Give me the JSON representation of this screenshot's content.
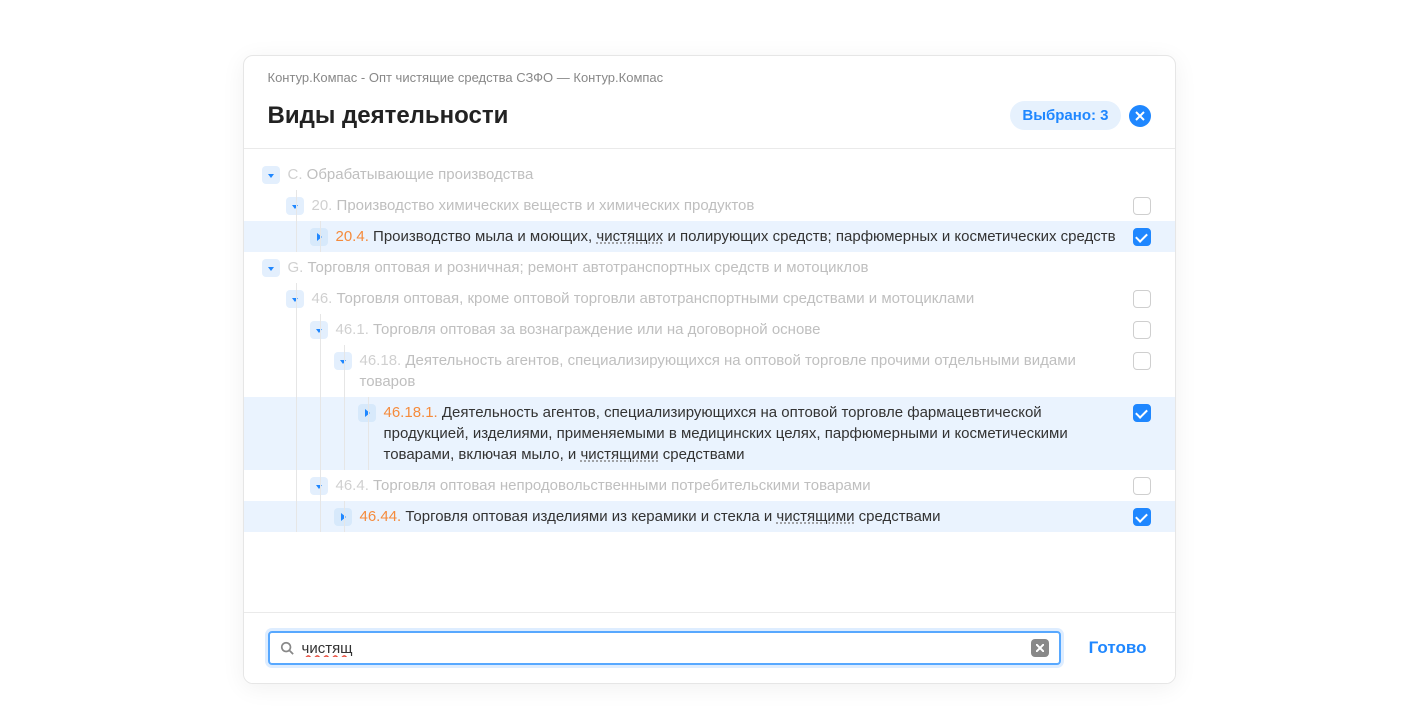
{
  "window_title": "Контур.Компас - Опт чистящие средства СЗФО — Контур.Компас",
  "page_title": "Виды деятельности",
  "selected_label": "Выбрано: 3",
  "done_label": "Готово",
  "search_value": "чистящ",
  "tree": {
    "c": {
      "code": "C.",
      "title": "Обрабатывающие производства",
      "c20": {
        "code": "20.",
        "title": "Производство химических веществ и химических продуктов",
        "c204": {
          "code": "20.4.",
          "pre": "Производство мыла и моющих, ",
          "match": "чистящих",
          "post": " и полирующих средств; парфюмерных и косметических средств"
        }
      }
    },
    "g": {
      "code": "G.",
      "title": "Торговля оптовая и розничная; ремонт автотранспортных средств и мотоциклов",
      "g46": {
        "code": "46.",
        "title": "Торговля оптовая, кроме оптовой торговли автотранспортными средствами и мотоциклами",
        "g461": {
          "code": "46.1.",
          "title": "Торговля оптовая за вознаграждение или на договорной основе",
          "g4618": {
            "code": "46.18.",
            "title": "Деятельность агентов, специализирующихся на оптовой торговле прочими отдельными видами товаров",
            "g46181": {
              "code": "46.18.1.",
              "pre": "Деятельность агентов, специализирующихся на оптовой торговле фармацевтической продукцией, изделиями, применяемыми в медицинских целях, парфюмерными и косметическими товарами, включая мыло, и ",
              "match": "чистящими",
              "post": " средствами"
            }
          }
        },
        "g464": {
          "code": "46.4.",
          "title": "Торговля оптовая непродовольственными потребительскими товарами",
          "g4644": {
            "code": "46.44.",
            "pre": "Торговля оптовая изделиями из керамики и стекла и ",
            "match": "чистящими",
            "post": " средствами"
          }
        }
      }
    }
  }
}
